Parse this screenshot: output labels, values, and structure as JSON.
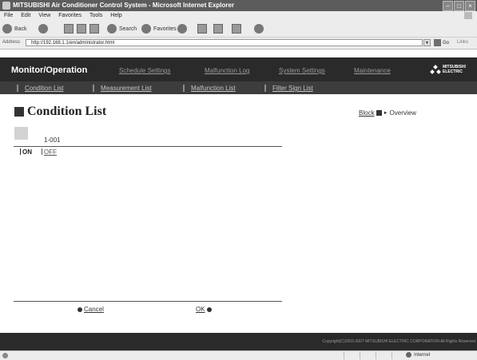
{
  "window": {
    "title": "MITSUBISHI Air Conditioner Control System - Microsoft Internet Explorer"
  },
  "menubar": {
    "items": [
      "File",
      "Edit",
      "View",
      "Favorites",
      "Tools",
      "Help"
    ]
  },
  "toolbar": {
    "back": "Back",
    "search": "Search",
    "favorites": "Favorites"
  },
  "address": {
    "label": "Address",
    "url": "http://192.168.1.1/en/administrator.html",
    "go": "Go",
    "links": "Links"
  },
  "nav": {
    "brand": "Monitor/Operation",
    "primary": [
      "Schedule Settings",
      "Malfunction Log",
      "System Settings",
      "Maintenance"
    ],
    "secondary": [
      "Condition List",
      "Measurement List",
      "Malfunction List",
      "Filter Sign List"
    ]
  },
  "logo": {
    "line1": "MITSUBISHI",
    "line2": "ELECTRIC"
  },
  "page": {
    "title": "Condition List",
    "block": "Block",
    "overview": "Overview",
    "unit": "1-001",
    "on": "ON",
    "off": "OFF",
    "cancel": "Cancel",
    "ok": "OK"
  },
  "footer": {
    "copyright": "Copyright(C)2003-2007 MITSUBISHI ELECTRIC CORPORATION All Rights Reserved"
  },
  "status": {
    "zone": "Internet"
  }
}
